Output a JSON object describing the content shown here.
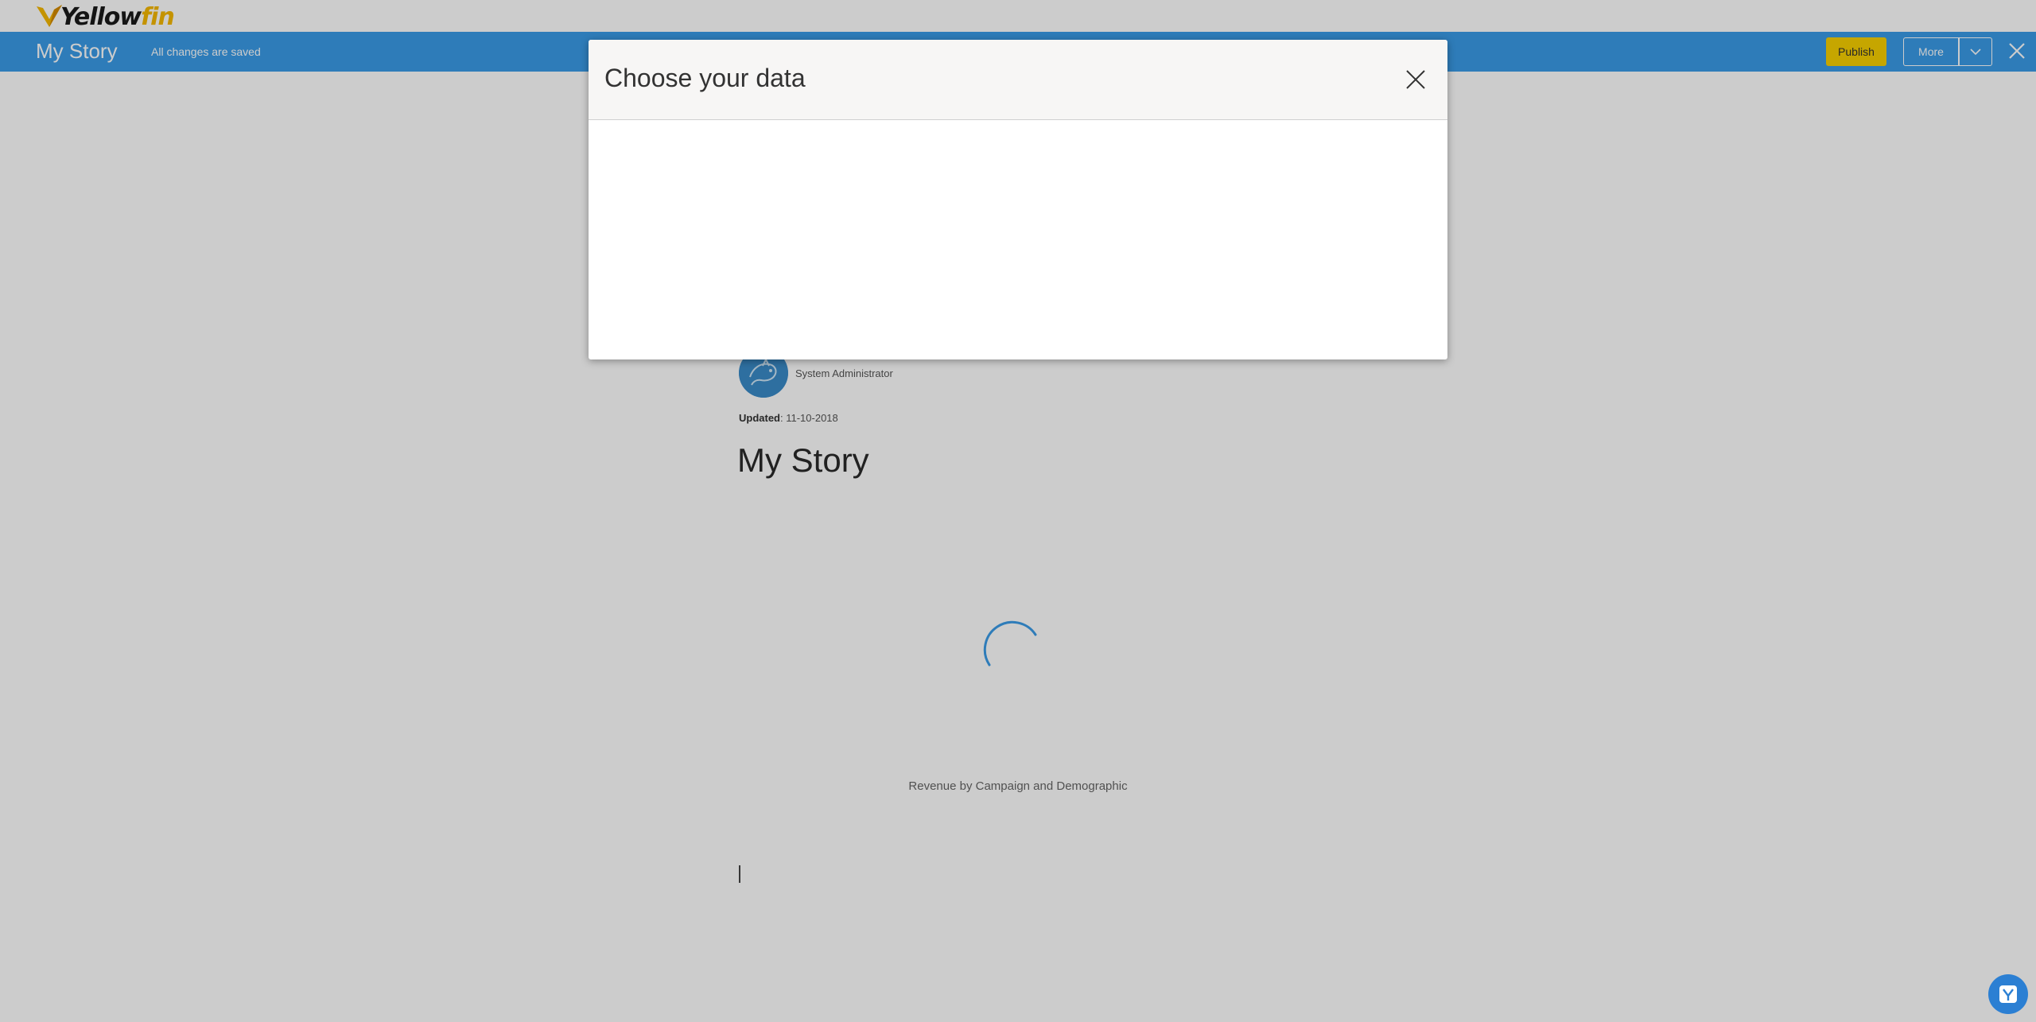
{
  "app": {
    "logo_text_main": "Yellow",
    "logo_text_accent": "fin",
    "brand_color": "#f5b800",
    "accent_color": "#3a9ce8"
  },
  "storybar": {
    "title": "My Story",
    "save_status": "All changes are saved",
    "publish_label": "Publish",
    "more_label": "More",
    "caret_icon": "chevron-down-icon",
    "close_icon": "close-icon"
  },
  "story": {
    "author": "System Administrator",
    "updated_label": "Updated",
    "updated_value": ": 11-10-2018",
    "title": "My Story",
    "chart_caption": "Revenue by Campaign and Demographic"
  },
  "modal": {
    "title": "Choose your data",
    "close_icon": "close-icon"
  },
  "help": {
    "icon": "yellowfin-help-icon"
  }
}
